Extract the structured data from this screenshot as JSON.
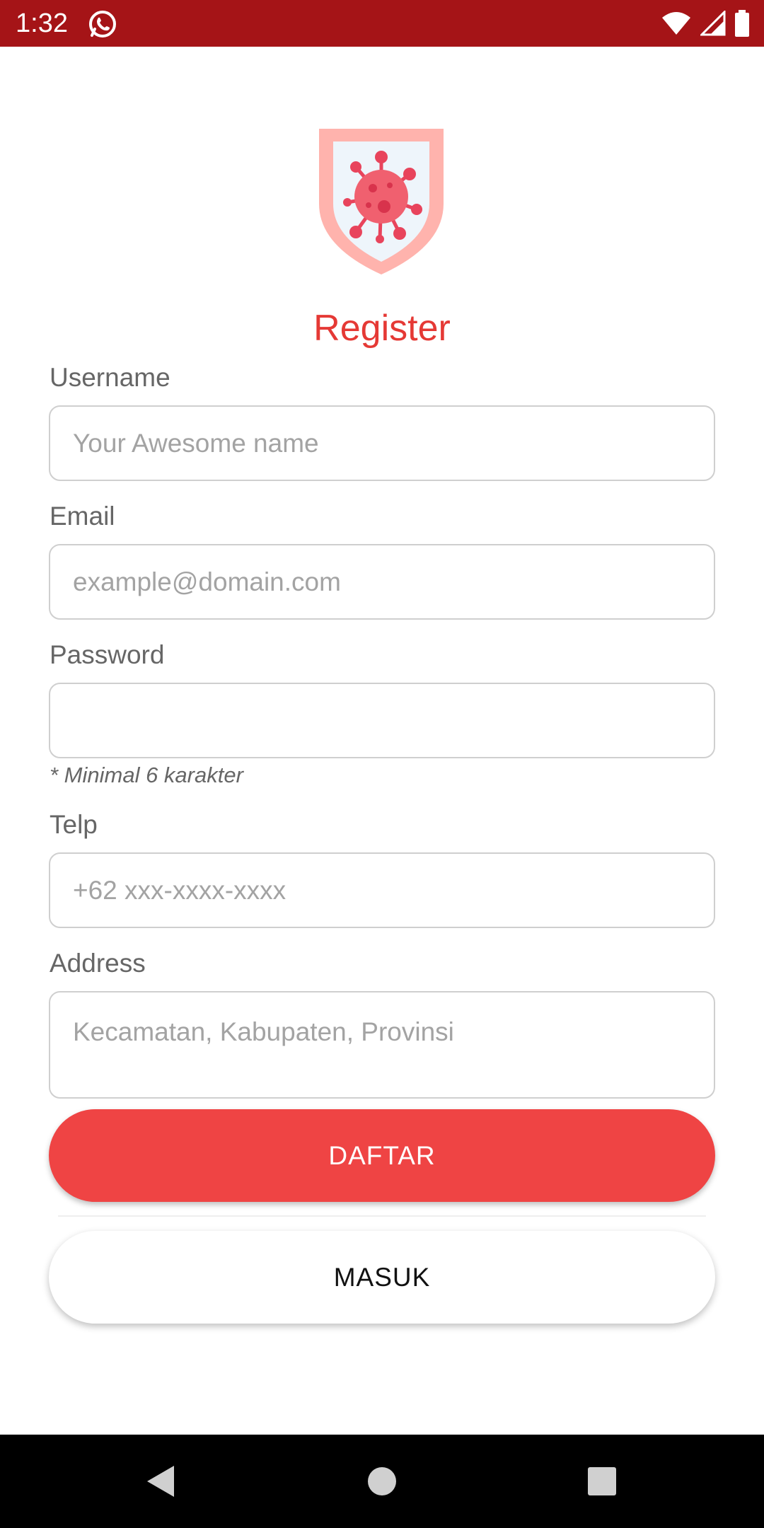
{
  "status_bar": {
    "time": "1:32",
    "icons": [
      "whatsapp-icon",
      "wifi-icon",
      "signal-icon",
      "battery-icon"
    ],
    "background": "#a51417"
  },
  "logo": {
    "icon": "virus-shield-icon"
  },
  "title": "Register",
  "form": {
    "username": {
      "label": "Username",
      "placeholder": "Your Awesome name",
      "value": ""
    },
    "email": {
      "label": "Email",
      "placeholder": "example@domain.com",
      "value": ""
    },
    "password": {
      "label": "Password",
      "placeholder": "",
      "value": "",
      "hint": "* Minimal 6 karakter"
    },
    "telp": {
      "label": "Telp",
      "placeholder": "+62 xxx-xxxx-xxxx",
      "value": ""
    },
    "address": {
      "label": "Address",
      "placeholder": "Kecamatan, Kabupaten, Provinsi",
      "value": ""
    }
  },
  "buttons": {
    "register_label": "DAFTAR",
    "login_label": "MASUK"
  },
  "colors": {
    "accent": "#e53935",
    "primary_button": "#ef4444"
  },
  "nav_bar": {
    "icons": [
      "back-icon",
      "home-icon",
      "recents-icon"
    ]
  }
}
